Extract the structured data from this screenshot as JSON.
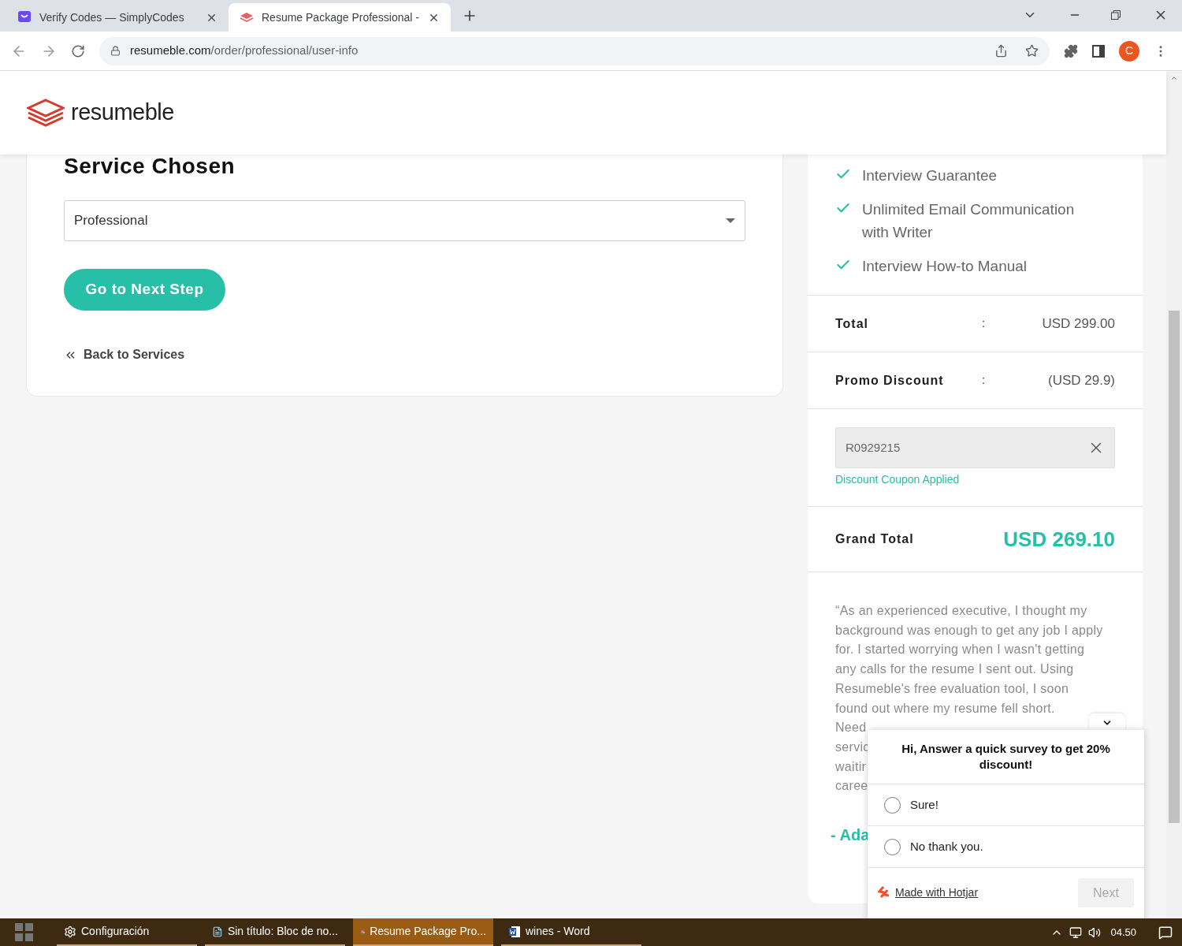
{
  "browser": {
    "tabs": [
      {
        "title": "Verify Codes — SimplyCodes",
        "kind": "simplycodes",
        "selected": false
      },
      {
        "title": "Resume Package Professional -",
        "kind": "resumeble",
        "selected": true
      }
    ],
    "url_host": "resumeble.com",
    "url_path": "/order/professional/user-info",
    "profile_initial": "C"
  },
  "site": {
    "logo": "resumeble"
  },
  "service": {
    "heading": "Service Chosen",
    "select_value": "Professional",
    "next_button": "Go to Next Step",
    "back_link": "Back to Services"
  },
  "summary": {
    "features": [
      "Interview Guarantee",
      "Unlimited Email Communication with Writer",
      "Interview How-to Manual"
    ],
    "total": {
      "label": "Total",
      "separator": ":",
      "value": "USD 299.00"
    },
    "promo": {
      "label": "Promo Discount",
      "separator": ":",
      "value": "(USD 29.9)"
    },
    "coupon": {
      "value": "R0929215",
      "status": "Discount Coupon Applied"
    },
    "grand_total": {
      "label": "Grand Total",
      "value": "USD 269.10"
    },
    "testimonial": {
      "lines": [
        "“As an experienced executive, I thought my",
        "background was enough to get any job I apply",
        "for. I started worrying when I wasn't getting",
        "any calls for the resume I sent out. Using",
        "Resumeble's free evaluation tool, I soon",
        "found out where my resume fell short.",
        "Need",
        "servic",
        "waitir",
        "caree"
      ],
      "author": "- Ada"
    }
  },
  "survey": {
    "title": "Hi, Answer a quick survey to get 20% discount!",
    "options": [
      {
        "label": "Sure!",
        "selected": false
      },
      {
        "label": "No thank you.",
        "selected": false
      }
    ],
    "credit": "Made with Hotjar",
    "next_button": "Next"
  },
  "taskbar": {
    "items": [
      {
        "label": "Configuración",
        "kind": "gear",
        "selected": false
      },
      {
        "label": "Sin título: Bloc de no...",
        "kind": "notepad",
        "selected": false
      },
      {
        "label": "Resume Package Pro...",
        "kind": "chrome",
        "selected": true
      },
      {
        "label": "wines - Word",
        "kind": "word",
        "selected": false
      }
    ],
    "time": "04.50"
  }
}
